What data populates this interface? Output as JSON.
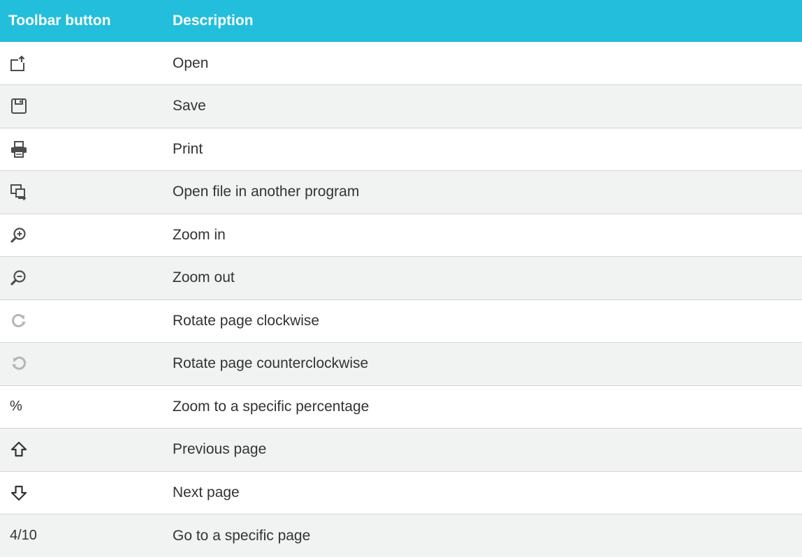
{
  "header": {
    "col1": "Toolbar button",
    "col2": "Description"
  },
  "rows": [
    {
      "icon": "open-icon",
      "description": "Open"
    },
    {
      "icon": "save-icon",
      "description": "Save"
    },
    {
      "icon": "print-icon",
      "description": "Print"
    },
    {
      "icon": "open-in-program-icon",
      "description": "Open file in another program"
    },
    {
      "icon": "zoom-in-icon",
      "description": "Zoom in"
    },
    {
      "icon": "zoom-out-icon",
      "description": "Zoom out"
    },
    {
      "icon": "rotate-clockwise-icon",
      "description": "Rotate page clockwise"
    },
    {
      "icon": "rotate-counterclockwise-icon",
      "description": "Rotate page counterclockwise"
    },
    {
      "text": "%",
      "description": "Zoom to a specific percentage"
    },
    {
      "icon": "previous-page-icon",
      "description": "Previous page"
    },
    {
      "icon": "next-page-icon",
      "description": "Next page"
    },
    {
      "text": "4/10",
      "description": "Go to a specific page"
    }
  ],
  "colors": {
    "header_bg": "#22bedc",
    "header_text": "#ffffff",
    "alt_row_bg": "#f1f2f2",
    "text": "#333333"
  }
}
